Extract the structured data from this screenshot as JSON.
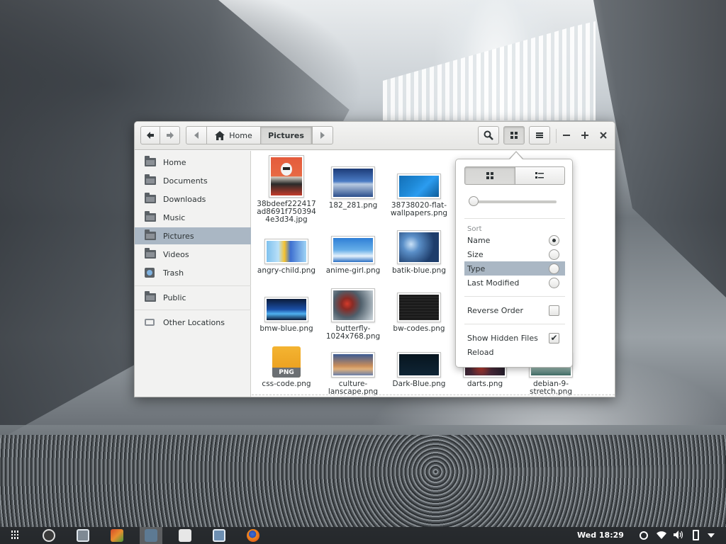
{
  "window": {
    "nav": {
      "back_icon": "arrow-left-icon",
      "forward_icon": "arrow-right-icon"
    },
    "breadcrumb": {
      "home_label": "Home",
      "current_label": "Pictures"
    }
  },
  "sidebar": {
    "items": [
      {
        "label": "Home",
        "icon": "home-folder-icon"
      },
      {
        "label": "Documents",
        "icon": "documents-folder-icon"
      },
      {
        "label": "Downloads",
        "icon": "downloads-folder-icon"
      },
      {
        "label": "Music",
        "icon": "music-folder-icon"
      },
      {
        "label": "Pictures",
        "icon": "pictures-folder-icon",
        "selected": true
      },
      {
        "label": "Videos",
        "icon": "videos-folder-icon"
      },
      {
        "label": "Trash",
        "icon": "trash-icon"
      },
      {
        "label": "Public",
        "icon": "public-folder-icon"
      },
      {
        "label": "Other Locations",
        "icon": "other-locations-icon"
      }
    ]
  },
  "files": [
    {
      "name": "38bdeef222417ad8691f7503944e3d34.jpg",
      "lines": [
        "38bdeef222417",
        "ad8691f750394",
        "4e3d34.jpg"
      ]
    },
    {
      "name": "182_281.png",
      "lines": [
        "182_281.png"
      ]
    },
    {
      "name": "38738020-flat-wallpapers.png",
      "lines": [
        "38738020-flat-",
        "wallpapers.png"
      ]
    },
    {
      "name": "angry-child.png",
      "lines": [
        "angry-child.png"
      ]
    },
    {
      "name": "anime-girl.png",
      "lines": [
        "anime-girl.png"
      ]
    },
    {
      "name": "batik-blue.png",
      "lines": [
        "batik-blue.png"
      ]
    },
    {
      "name": "bmw-blue.png",
      "lines": [
        "bmw-blue.png"
      ]
    },
    {
      "name": "butterfly-1024x768.png",
      "lines": [
        "butterfly-",
        "1024x768.png"
      ]
    },
    {
      "name": "bw-codes.png",
      "lines": [
        "bw-codes.png"
      ]
    },
    {
      "name": "css-code.png",
      "lines": [
        "css-code.png"
      ]
    },
    {
      "name": "culture-lanscape.png",
      "lines": [
        "culture-",
        "lanscape.png"
      ]
    },
    {
      "name": "Dark-Blue.png",
      "lines": [
        "Dark-Blue.png"
      ]
    },
    {
      "name": "darts.png",
      "lines": [
        "darts.png"
      ]
    },
    {
      "name": "debian-9-stretch.png",
      "lines": [
        "debian-9-",
        "stretch.png"
      ]
    }
  ],
  "popover": {
    "sort_heading": "Sort",
    "options": [
      {
        "label": "Name",
        "checked": true
      },
      {
        "label": "Size",
        "checked": false
      },
      {
        "label": "Type",
        "checked": false,
        "highlighted": true
      },
      {
        "label": "Last Modified",
        "checked": false
      }
    ],
    "reverse_order": {
      "label": "Reverse Order",
      "checked": false
    },
    "show_hidden": {
      "label": "Show Hidden Files",
      "checked": true
    },
    "reload_label": "Reload",
    "zoom_level": 0.0
  },
  "png_badge": "PNG",
  "taskbar": {
    "clock": "Wed 18:29"
  }
}
